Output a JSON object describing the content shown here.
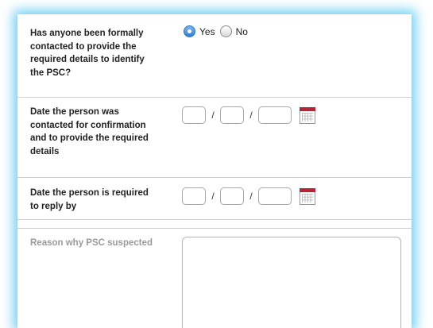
{
  "form": {
    "psc_contacted": {
      "label": "Has anyone been formally contacted to provide the required details to identify the PSC?",
      "options": [
        {
          "label": "Yes",
          "selected": true
        },
        {
          "label": "No",
          "selected": false
        }
      ]
    },
    "contact_date": {
      "label": "Date the person was contacted for confirmation and to provide the required details",
      "separator": "/",
      "day": "",
      "month": "",
      "year": ""
    },
    "reply_by_date": {
      "label": "Date the person is required to reply by",
      "separator": "/",
      "day": "",
      "month": "",
      "year": ""
    },
    "reason": {
      "label": "Reason why PSC suspected",
      "value": ""
    }
  },
  "colors": {
    "focus_glow": "#3cbef0",
    "radio_selected": "#2d7ed3",
    "calendar_accent": "#b5253a",
    "divider": "#d0d0d0",
    "muted_label": "#9a9a9a"
  },
  "icons": {
    "calendar": "calendar-icon"
  }
}
